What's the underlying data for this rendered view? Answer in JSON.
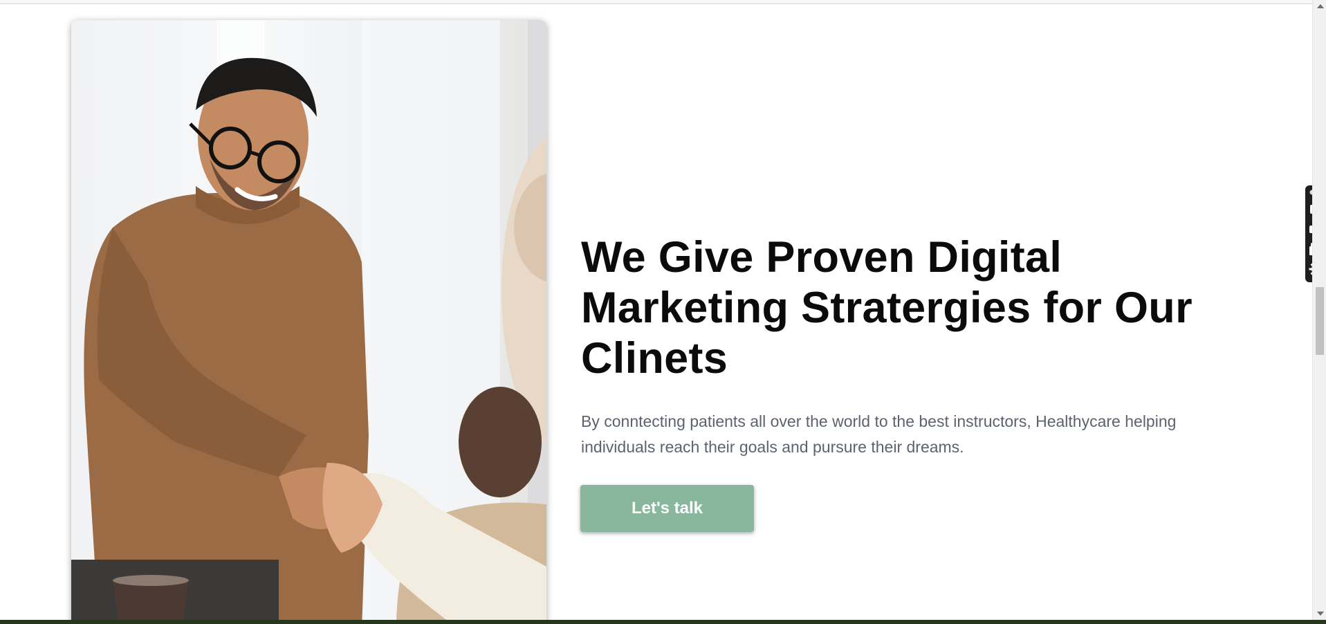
{
  "hero": {
    "image_alt": "Smiling man in glasses and brown sweater shaking hands",
    "title": "We Give Proven Digital Marketing Stratergies for Our Clinets",
    "description": "By conntecting patients all over the world to the best instructors, Healthycare helping individuals reach their goals and pursure their dreams.",
    "cta_label": "Let's talk"
  },
  "tool_widget": {
    "icons": [
      "screenshot-icon",
      "video-icon",
      "window-icon",
      "gear-icon"
    ]
  },
  "colors": {
    "cta_background": "#89b79e",
    "title_text": "#0b0b0b",
    "description_text": "#5b6270",
    "bottom_strip": "#27361f"
  }
}
